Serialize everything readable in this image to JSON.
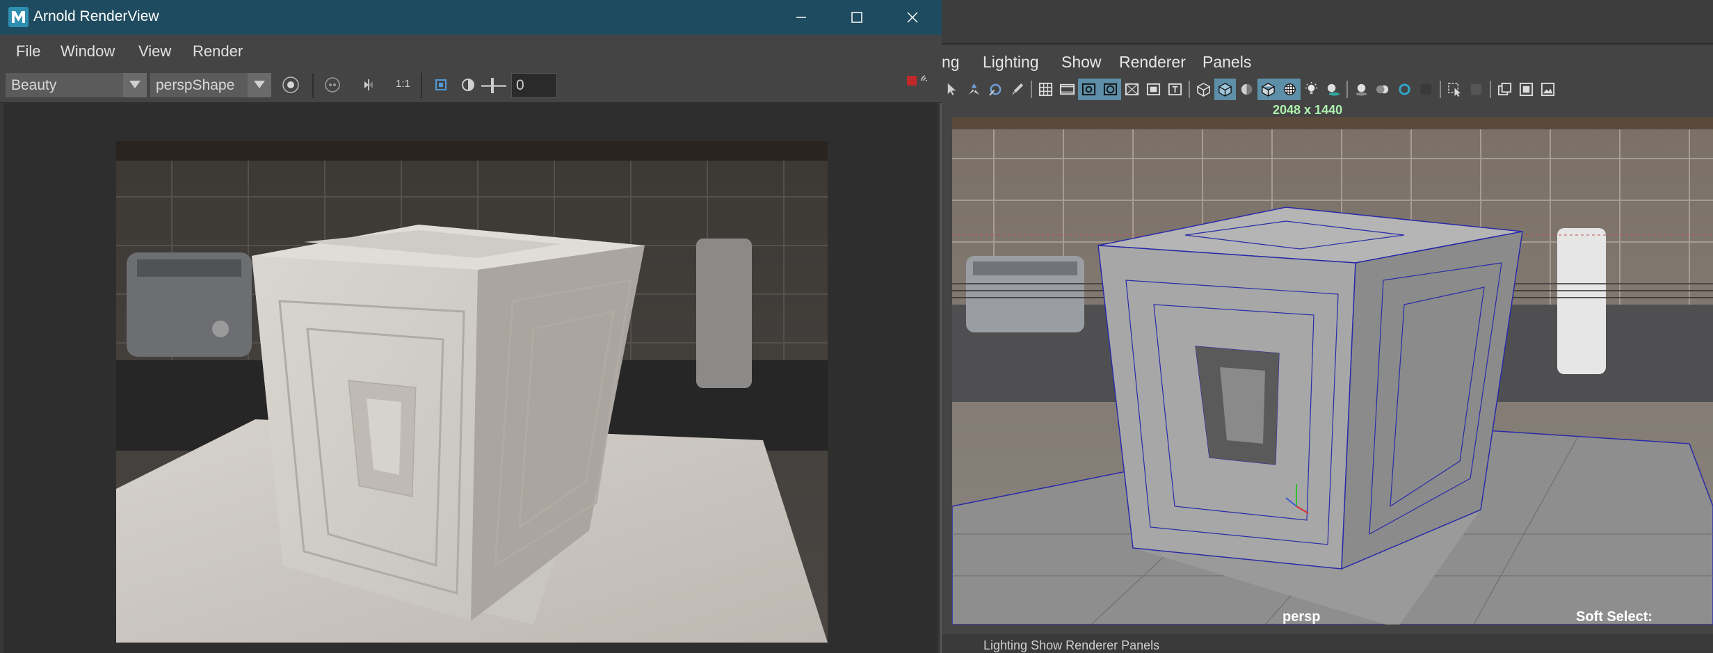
{
  "arnold_window": {
    "title": "Arnold RenderView",
    "menu": [
      "File",
      "Window",
      "View",
      "Render"
    ],
    "toolbar": {
      "aov_value": "Beauty",
      "camera_value": "perspShape",
      "ratio_label": "1:1",
      "exposure_value": "0"
    }
  },
  "maya_window": {
    "menu": [
      "ng",
      "Lighting",
      "Show",
      "Renderer",
      "Panels"
    ],
    "resolution_label": "2048 x 1440",
    "camera_label": "persp",
    "soft_select_label": "Soft Select:",
    "bottom_text": "Lighting   Show   Renderer   Panels"
  },
  "colors": {
    "titlebar": "#1e4b5f",
    "active_button": "#5d8fa8",
    "resolution_text": "#aef0ae",
    "wireframe": "#2a2aa8"
  },
  "icons": {
    "maya_toolbar": [
      "select-tool-icon",
      "move-tool-icon",
      "rotate-tool-icon",
      "paint-tool-icon",
      "grid-icon",
      "film-gate-icon",
      "resolution-gate-icon",
      "gate-mask-icon",
      "field-chart-icon",
      "safe-action-icon",
      "safe-title-icon",
      "wireframe-icon",
      "smooth-shade-icon",
      "default-material-icon",
      "wireframe-on-shaded-icon",
      "xray-icon",
      "all-lights-icon",
      "shadows-icon",
      "ambient-occlusion-icon",
      "motion-blur-icon",
      "anti-aliasing-icon",
      "isolate-select-icon",
      "highlight-icon",
      "two-panel-icon",
      "single-panel-icon",
      "image-plane-icon"
    ]
  }
}
